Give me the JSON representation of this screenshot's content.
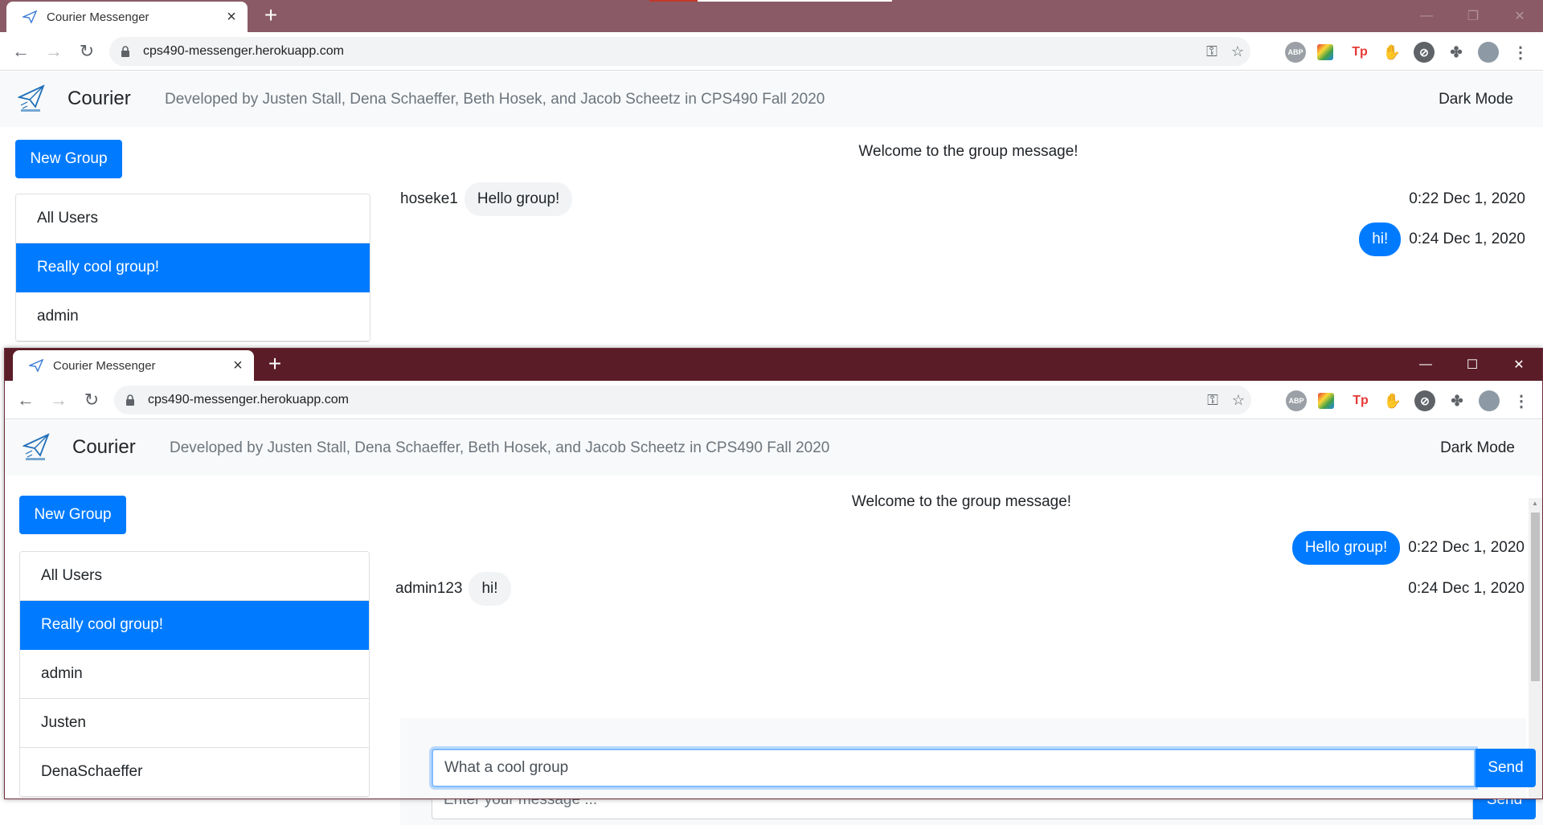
{
  "colors": {
    "titlebar_back": "#8a5a66",
    "titlebar_front": "#5a1d27",
    "accent": "#007bff"
  },
  "window_back": {
    "tab_title": "Courier Messenger",
    "url": "cps490-messenger.herokuapp.com",
    "brand": "Courier",
    "tagline": "Developed by Justen Stall, Dena Schaeffer, Beth Hosek, and Jacob Scheetz in CPS490 Fall 2020",
    "dark_mode": "Dark Mode",
    "new_group": "New Group",
    "list": [
      "All Users",
      "Really cool group!",
      "admin"
    ],
    "welcome": "Welcome to the group message!",
    "messages": [
      {
        "sender": "hoseke1",
        "text": "Hello group!",
        "time": "0:22 Dec 1, 2020",
        "outgoing": false
      },
      {
        "sender": "",
        "text": "hi!",
        "time": "0:24 Dec 1, 2020",
        "outgoing": true
      }
    ],
    "input_placeholder": "Enter your message ...",
    "send": "Send"
  },
  "window_front": {
    "tab_title": "Courier Messenger",
    "url": "cps490-messenger.herokuapp.com",
    "brand": "Courier",
    "tagline": "Developed by Justen Stall, Dena Schaeffer, Beth Hosek, and Jacob Scheetz in CPS490 Fall 2020",
    "dark_mode": "Dark Mode",
    "new_group": "New Group",
    "list": [
      "All Users",
      "Really cool group!",
      "admin",
      "Justen",
      "DenaSchaeffer"
    ],
    "welcome": "Welcome to the group message!",
    "messages": [
      {
        "sender": "",
        "text": "Hello group!",
        "time": "0:22 Dec 1, 2020",
        "outgoing": true
      },
      {
        "sender": "admin123",
        "text": "hi!",
        "time": "0:24 Dec 1, 2020",
        "outgoing": false
      }
    ],
    "input_value": "What a cool group",
    "send": "Send"
  },
  "extensions": [
    "ABP",
    "Tp"
  ]
}
